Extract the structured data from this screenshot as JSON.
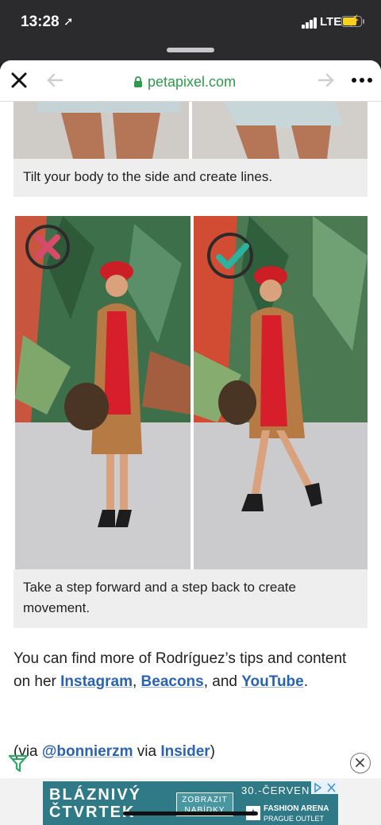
{
  "status_bar": {
    "time": "13:28",
    "carrier": "LTE"
  },
  "browser": {
    "url": "petapixel.com"
  },
  "captions": {
    "first": "Tilt your body to the side and create lines.",
    "second": "Take a step forward and a step back to create movement."
  },
  "paragraph": {
    "prefix": "You can find more of Rodríguez’s tips and content on her ",
    "link_instagram": "Instagram",
    "sep1": ", ",
    "link_beacons": "Beacons",
    "sep2": ", and ",
    "link_youtube": "YouTube",
    "suffix": "."
  },
  "credit": {
    "prefix": "(via ",
    "link_author": "@bonnierzm",
    "middle": " via ",
    "link_source": "Insider",
    "suffix": ")"
  },
  "ad": {
    "title_line1": "BLÁZNIVÝ",
    "title_line2": "ČTVRTEK",
    "button": "ZOBRAZIT NABÍDKY",
    "date": "30.-ČERVEN",
    "brand_line1": "FASHION ARENA",
    "brand_line2": "PRAGUE OUTLET"
  },
  "icons": {
    "wrong": "x-mark-icon",
    "right": "check-mark-icon"
  },
  "colors": {
    "link": "#2b63b3",
    "url": "#2e9a4a",
    "wrong_mark": "#d64a6a",
    "right_mark": "#2bb3a0"
  }
}
